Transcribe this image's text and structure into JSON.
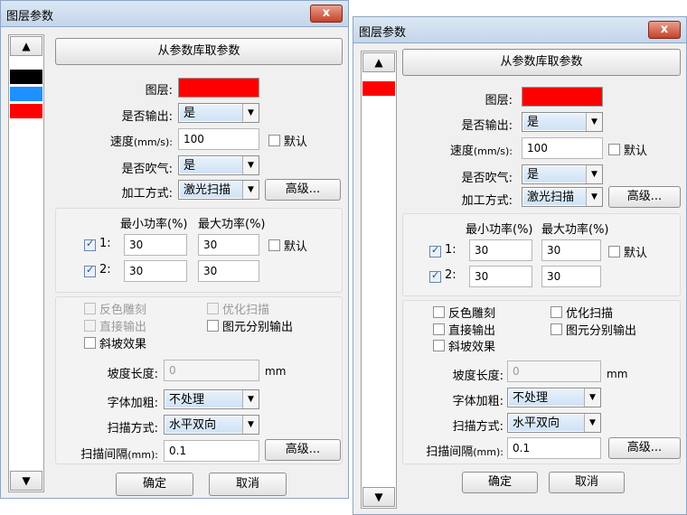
{
  "dialog": {
    "title": "图层参数",
    "close": "x",
    "fetch_button": "从参数库取参数",
    "labels": {
      "layer": "图层:",
      "output": "是否输出:",
      "speed_main": "速度",
      "speed_unit": "(mm/s):",
      "blow": "是否吹气:",
      "process": "加工方式:",
      "min_power": "最小功率(%)",
      "max_power": "最大功率(%)",
      "default": "默认",
      "row1": "1:",
      "row2": "2:",
      "reverse": "反色雕刻",
      "optimize": "优化扫描",
      "direct": "直接输出",
      "separate": "图元分别输出",
      "slope": "斜坡效果",
      "slope_len": "坡度长度:",
      "mm": "mm",
      "bold": "字体加粗:",
      "scan_mode": "扫描方式:",
      "interval_main": "扫描间隔",
      "interval_unit": "(mm):"
    },
    "values": {
      "output": "是",
      "speed": "100",
      "blow": "是",
      "process": "激光扫描",
      "power1_min": "30",
      "power1_max": "30",
      "power2_min": "30",
      "power2_max": "30",
      "slope_len": "0",
      "bold": "不处理",
      "scan_mode": "水平双向",
      "interval": "0.1"
    },
    "advanced_button": "高级...",
    "ok_button": "确定",
    "cancel_button": "取消"
  },
  "colors": {
    "layer_red": "#ff0000",
    "swatch_black": "#000000",
    "swatch_blue": "#1e90ff",
    "swatch_red": "#ff0000"
  },
  "strip_icons": {
    "up": "triangle-up-icon",
    "down": "triangle-down-icon"
  }
}
